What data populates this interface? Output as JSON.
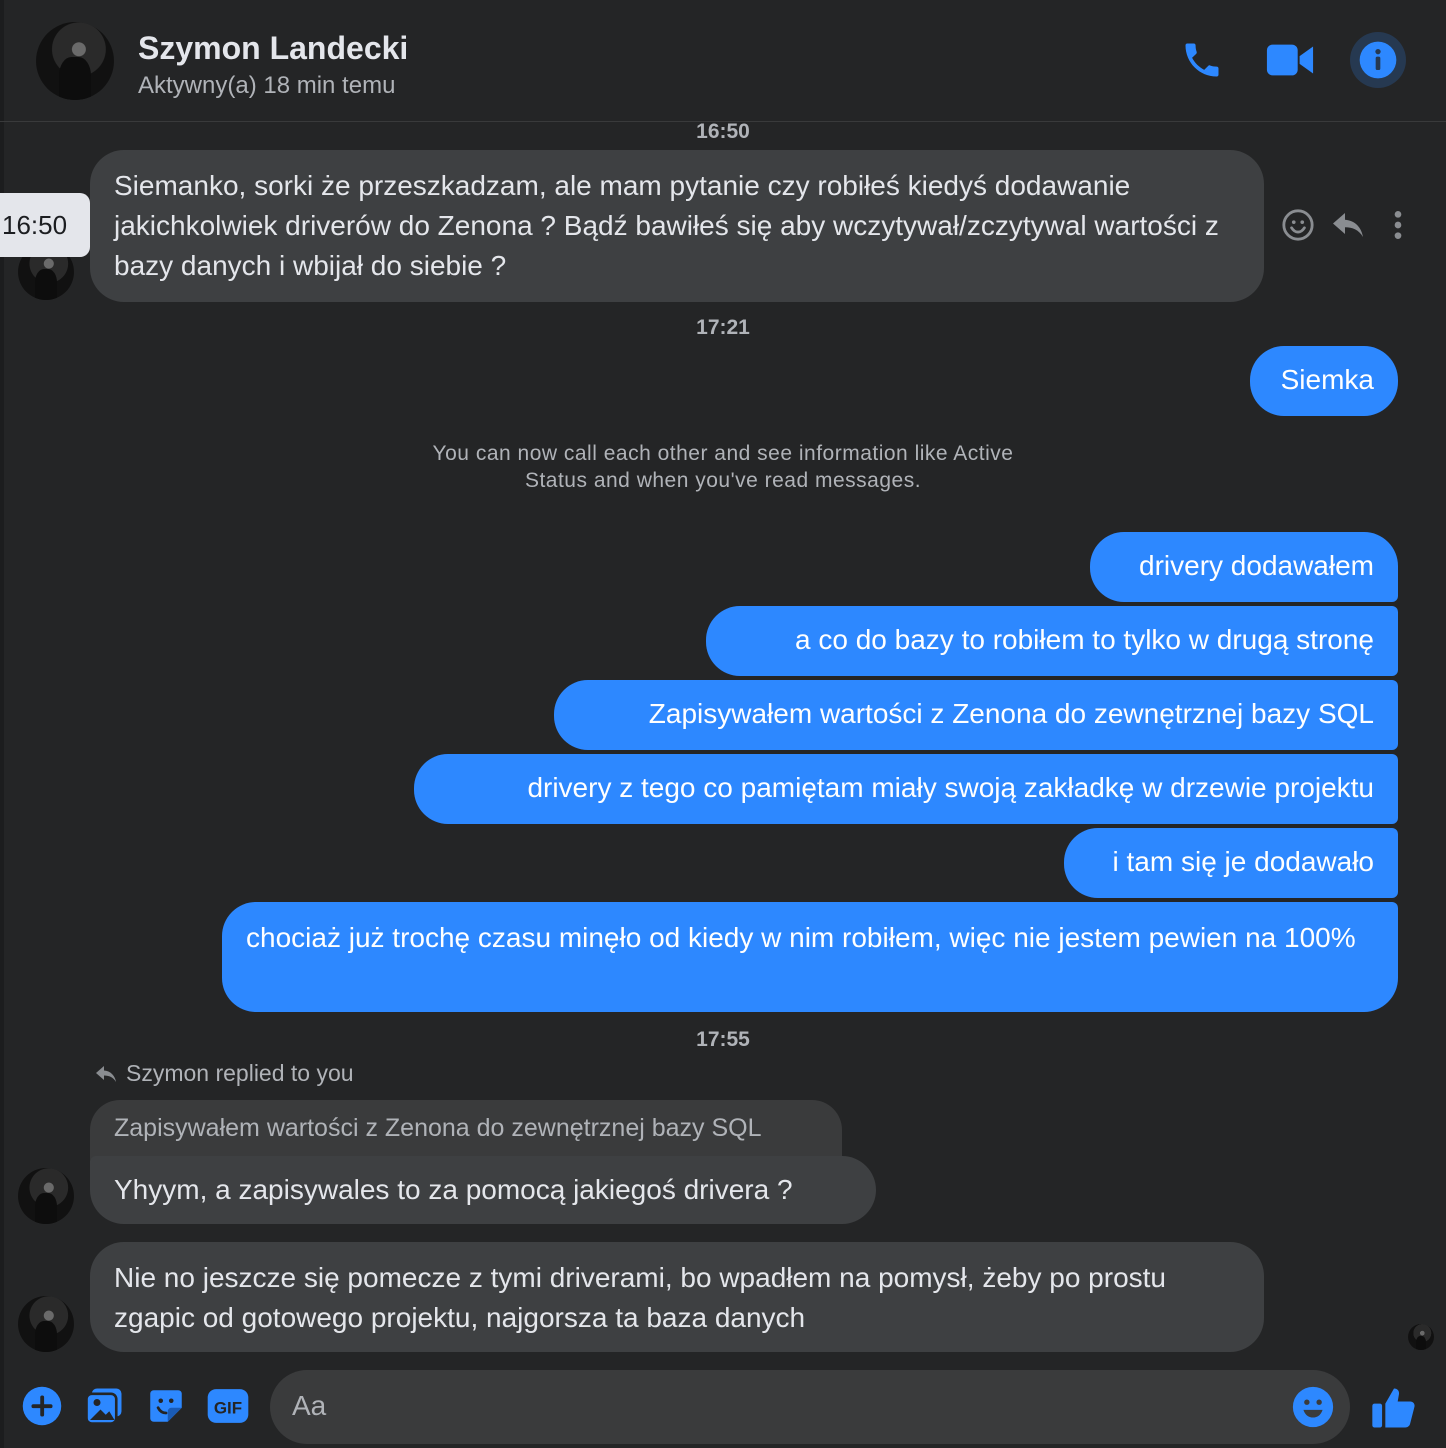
{
  "header": {
    "name": "Szymon Landecki",
    "status": "Aktywny(a) 18 min temu"
  },
  "timestamps": {
    "t1": "16:50",
    "t2": "17:21",
    "t3": "17:55"
  },
  "tooltip_time": "16:50",
  "messages": {
    "m1": "Siemanko, sorki że przeszkadzam, ale mam pytanie czy robiłeś kiedyś dodawanie jakichkolwiek driverów do Zenona ? Bądź bawiłeś się aby wczytywał/zczytywal wartości z bazy danych i wbijał do siebie ?",
    "m2": "Siemka",
    "m3": "drivery dodawałem",
    "m4": "a co do bazy to robiłem to tylko w drugą stronę",
    "m5": "Zapisywałem wartości z Zenona do zewnętrznej bazy SQL",
    "m6": "drivery z tego co pamiętam miały swoją zakładkę w drzewie projektu",
    "m7": "i tam się je dodawało",
    "m8": "chociaż już trochę czasu minęło od kiedy w nim robiłem, więc nie jestem pewien na 100%",
    "m9": "Yhyym, a zapisywales to za pomocą jakiegoś drivera ?",
    "m10": "Nie no jeszcze się pomecze z tymi driverami, bo wpadłem na pomysł, żeby po prostu zgapic od gotowego projektu, najgorsza ta baza danych"
  },
  "system_note": "You can now call each other and see information like Active Status and when you've read messages.",
  "reply": {
    "label": "Szymon replied to you",
    "quoted": "Zapisywałem wartości z Zenona do zewnętrznej bazy SQL"
  },
  "composer": {
    "placeholder": "Aa"
  },
  "colors": {
    "background": "#242526",
    "incoming_bubble": "#3e4042",
    "outgoing_bubble": "#2d88ff",
    "accent": "#2d88ff"
  }
}
